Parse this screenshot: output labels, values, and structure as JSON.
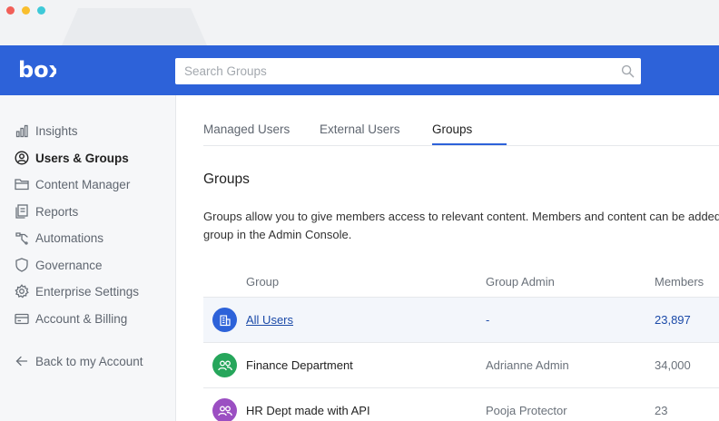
{
  "brand": {
    "logo_text": "box",
    "header_color": "#2d62d9"
  },
  "search": {
    "placeholder": "Search Groups"
  },
  "sidebar": {
    "items": [
      {
        "label": "Insights",
        "icon": "bar-chart-icon",
        "active": false
      },
      {
        "label": "Users & Groups",
        "icon": "user-circle-icon",
        "active": true
      },
      {
        "label": "Content Manager",
        "icon": "folder-icon",
        "active": false
      },
      {
        "label": "Reports",
        "icon": "report-icon",
        "active": false
      },
      {
        "label": "Automations",
        "icon": "automation-icon",
        "active": false
      },
      {
        "label": "Governance",
        "icon": "shield-icon",
        "active": false
      },
      {
        "label": "Enterprise Settings",
        "icon": "gear-icon",
        "active": false
      },
      {
        "label": "Account & Billing",
        "icon": "credit-card-icon",
        "active": false
      }
    ],
    "back_label": "Back to my Account"
  },
  "tabs": [
    {
      "label": "Managed Users",
      "active": false
    },
    {
      "label": "External Users",
      "active": false
    },
    {
      "label": "Groups",
      "active": true
    }
  ],
  "main": {
    "title": "Groups",
    "description": "Groups allow you to give members access to relevant content. Members and content can be added to a group in the Admin Console."
  },
  "table": {
    "headers": {
      "group": "Group",
      "admin": "Group Admin",
      "members": "Members"
    },
    "rows": [
      {
        "name": "All Users",
        "admin": "-",
        "members": "23,897",
        "avatar_color": "#2d62d9",
        "icon": "building-icon"
      },
      {
        "name": "Finance Department",
        "admin": "Adrianne Admin",
        "members": "34,000",
        "avatar_color": "#26a65b",
        "icon": "people-icon"
      },
      {
        "name": "HR Dept made with API",
        "admin": "Pooja Protector",
        "members": "23",
        "avatar_color": "#9b4fc2",
        "icon": "people-icon"
      }
    ]
  }
}
